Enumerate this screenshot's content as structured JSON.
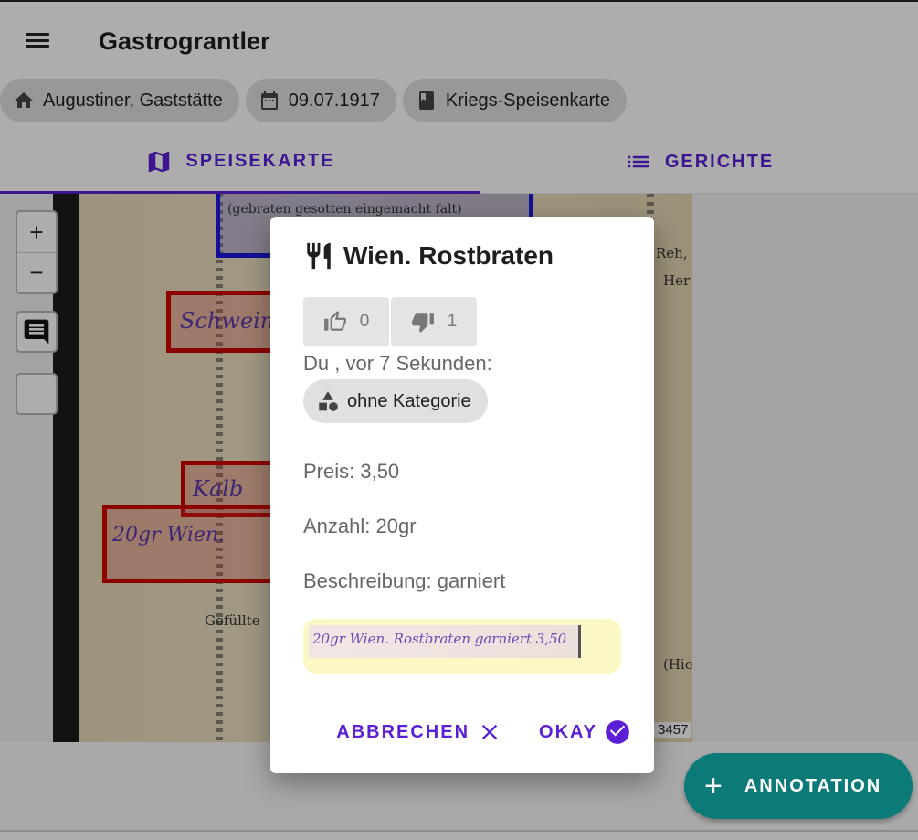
{
  "app": {
    "title": "Gastrograntler"
  },
  "chips": [
    {
      "icon": "home-icon",
      "label": "Augustiner, Gaststätte"
    },
    {
      "icon": "calendar-icon",
      "label": "09.07.1917"
    },
    {
      "icon": "book-icon",
      "label": "Kriegs-Speisenkarte"
    }
  ],
  "tabs": [
    {
      "icon": "map-icon",
      "label": "SPEISEKARTE",
      "active": true
    },
    {
      "icon": "list-icon",
      "label": "GERICHTE",
      "active": false
    }
  ],
  "map": {
    "zoom_in": "+",
    "zoom_out": "−",
    "id_label": "3457",
    "scan_text": {
      "blue_box": "(gebraten gesotten eingemacht falt)",
      "line1": "Schwein",
      "line2": "Kalb",
      "line3": "20gr Wien.",
      "printed": "Gefüllte",
      "right1": "Reh,",
      "right2": "Her",
      "right3": "(Hie"
    }
  },
  "fab": {
    "label": "ANNOTATION"
  },
  "dialog": {
    "title": "Wien. Rostbraten",
    "votes": {
      "up": "0",
      "down": "1"
    },
    "meta": "Du , vor 7 Sekunden:",
    "category": "ohne Kategorie",
    "price": "Preis: 3,50",
    "amount": "Anzahl: 20gr",
    "description": "Beschreibung: garniert",
    "snippet_text": "20gr Wien. Rostbraten garniert 3,50",
    "cancel": "ABBRECHEN",
    "ok": "OKAY"
  },
  "colors": {
    "accent": "#5b1fd6",
    "fab": "#0c7a77",
    "highlight": "#fbf8c6",
    "annotation_box": "#d00000"
  }
}
